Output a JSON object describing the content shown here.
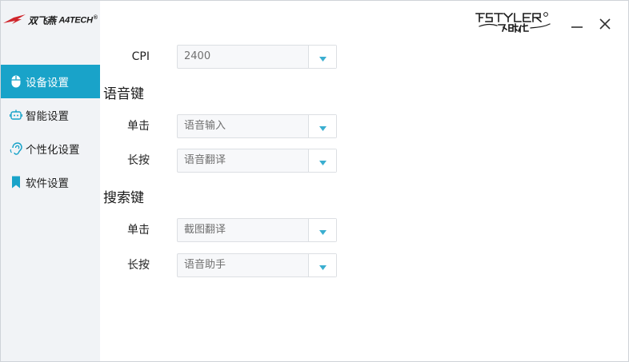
{
  "brand": {
    "name_cn": "双飞燕",
    "name_en": "A4TECH",
    "reg": "®",
    "logo_icon": "swallow-logo-icon"
  },
  "title_bar": {
    "product_logo": "FSTYLER 飞时代",
    "minimize_icon": "minimize-icon",
    "close_icon": "close-icon"
  },
  "sidebar": {
    "items": [
      {
        "label": "设备设置",
        "icon": "mouse-icon",
        "active": true
      },
      {
        "label": "智能设置",
        "icon": "robot-icon",
        "active": false
      },
      {
        "label": "个性化设置",
        "icon": "ear-icon",
        "active": false
      },
      {
        "label": "软件设置",
        "icon": "bookmark-icon",
        "active": false
      }
    ]
  },
  "settings": {
    "cpi": {
      "label": "CPI",
      "value": "2400"
    },
    "voice_key": {
      "title": "语音键",
      "single_click": {
        "label": "单击",
        "value": "语音输入"
      },
      "long_press": {
        "label": "长按",
        "value": "语音翻译"
      }
    },
    "search_key": {
      "title": "搜索键",
      "single_click": {
        "label": "单击",
        "value": "截图翻译"
      },
      "long_press": {
        "label": "长按",
        "value": "语音助手"
      }
    }
  },
  "colors": {
    "accent": "#19a3c9",
    "sidebar_bg": "#f1f3f6",
    "dropdown_arrow": "#3aaed0"
  }
}
